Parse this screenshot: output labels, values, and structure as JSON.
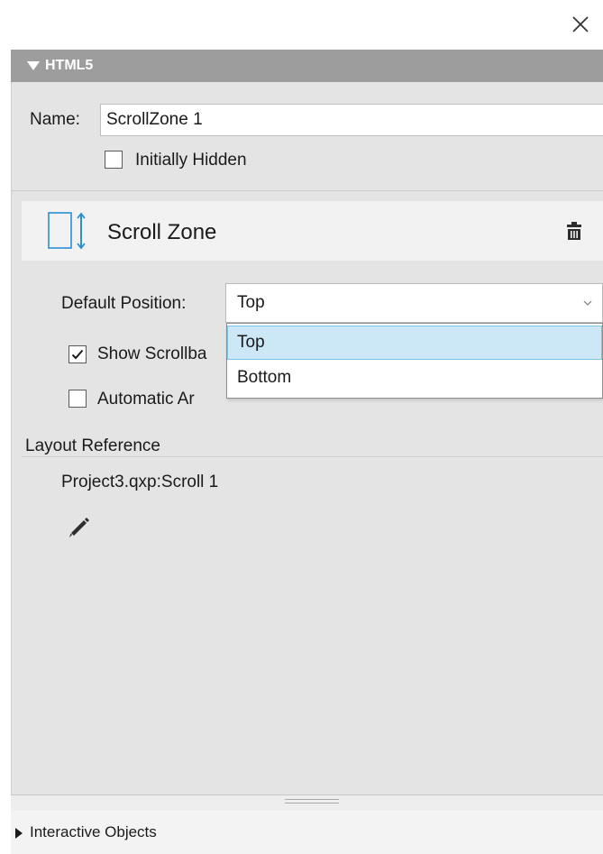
{
  "window": {
    "close_icon": "close-icon"
  },
  "section": {
    "title": "HTML5",
    "icon": "triangle-down-icon"
  },
  "name_field": {
    "label": "Name:",
    "value": "ScrollZone 1"
  },
  "initially_hidden": {
    "label": "Initially Hidden",
    "checked": false
  },
  "scroll_zone": {
    "title": "Scroll Zone",
    "icon": "scroll-zone-icon",
    "delete_icon": "trash-icon"
  },
  "default_position": {
    "label": "Default Position:",
    "value": "Top",
    "options": [
      "Top",
      "Bottom"
    ],
    "highlighted": "Top"
  },
  "show_scrollbars": {
    "label": "Show Scrollbars",
    "visible_label": "Show Scrollba",
    "checked": true
  },
  "automatic_arrows": {
    "label": "Automatic Arrows",
    "visible_label": "Automatic Ar",
    "checked": false
  },
  "layout_reference": {
    "label": "Layout Reference",
    "value": "Project3.qxp:Scroll 1",
    "edit_icon": "pencil-icon"
  },
  "footer": {
    "interactive_objects_label": "Interactive Objects",
    "icon": "triangle-right-icon"
  },
  "colors": {
    "header_bg": "#9d9d9d",
    "panel_bg": "#e4e4e4",
    "card_bg": "#f2f2f2",
    "accent_blue": "#2b8fd6",
    "selected_option_bg": "#cce8f6"
  }
}
